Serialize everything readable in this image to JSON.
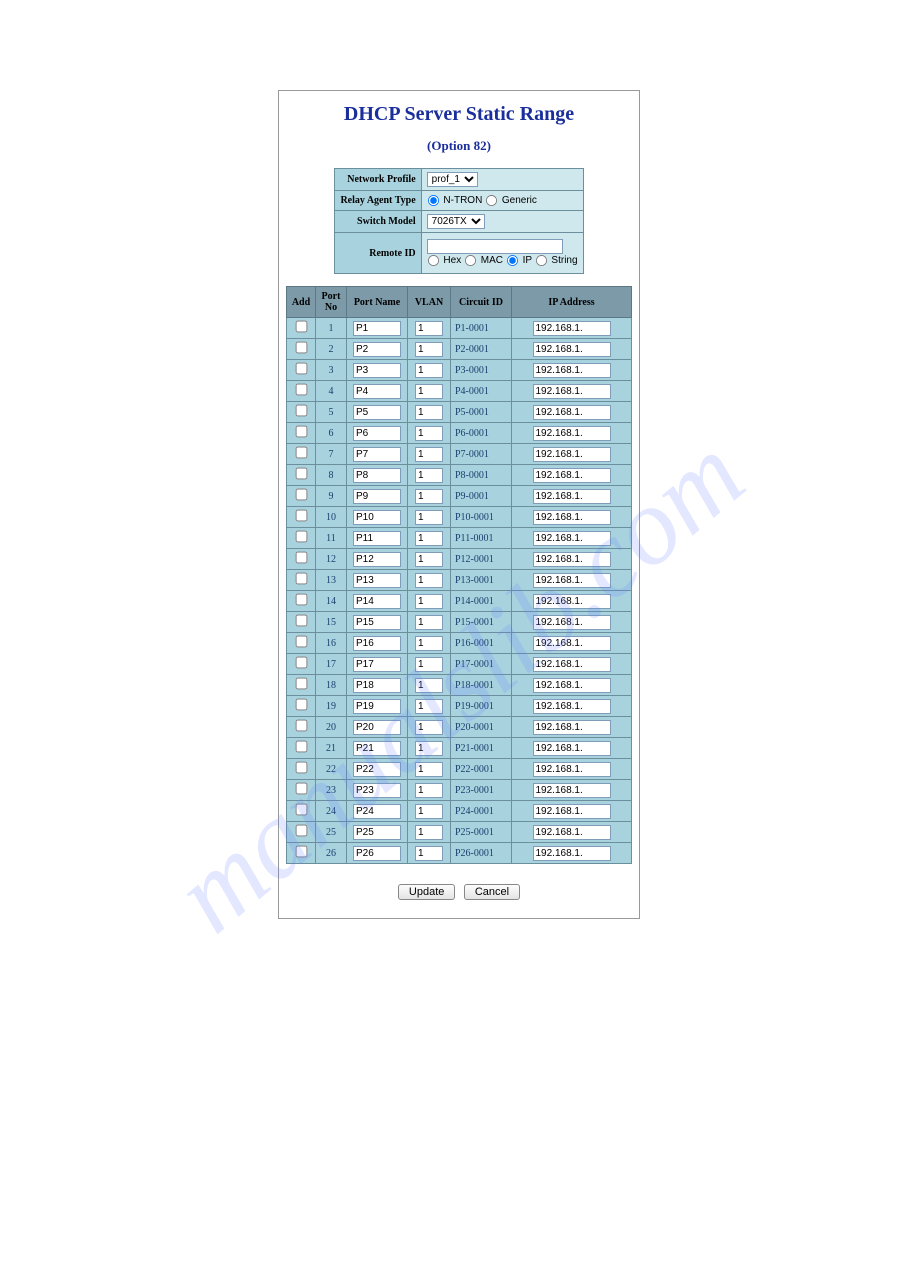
{
  "title": "DHCP Server Static Range",
  "subtitle": "(Option 82)",
  "config": {
    "network_profile_label": "Network Profile",
    "network_profile_value": "prof_1",
    "relay_agent_type_label": "Relay Agent Type",
    "relay_agent_ntron": "N-TRON",
    "relay_agent_generic": "Generic",
    "relay_agent_selected": "ntron",
    "switch_model_label": "Switch Model",
    "switch_model_value": "7026TX",
    "remote_id_label": "Remote ID",
    "remote_id_value": "",
    "remote_id_opt_hex": "Hex",
    "remote_id_opt_mac": "MAC",
    "remote_id_opt_ip": "IP",
    "remote_id_opt_string": "String",
    "remote_id_selected": "ip"
  },
  "table_headers": {
    "add": "Add",
    "port_no": "Port No",
    "port_name": "Port Name",
    "vlan": "VLAN",
    "circuit_id": "Circuit ID",
    "ip": "IP Address"
  },
  "rows": [
    {
      "no": "1",
      "pname": "P1",
      "vlan": "1",
      "cid": "P1-0001",
      "ip": "192.168.1."
    },
    {
      "no": "2",
      "pname": "P2",
      "vlan": "1",
      "cid": "P2-0001",
      "ip": "192.168.1."
    },
    {
      "no": "3",
      "pname": "P3",
      "vlan": "1",
      "cid": "P3-0001",
      "ip": "192.168.1."
    },
    {
      "no": "4",
      "pname": "P4",
      "vlan": "1",
      "cid": "P4-0001",
      "ip": "192.168.1."
    },
    {
      "no": "5",
      "pname": "P5",
      "vlan": "1",
      "cid": "P5-0001",
      "ip": "192.168.1."
    },
    {
      "no": "6",
      "pname": "P6",
      "vlan": "1",
      "cid": "P6-0001",
      "ip": "192.168.1."
    },
    {
      "no": "7",
      "pname": "P7",
      "vlan": "1",
      "cid": "P7-0001",
      "ip": "192.168.1."
    },
    {
      "no": "8",
      "pname": "P8",
      "vlan": "1",
      "cid": "P8-0001",
      "ip": "192.168.1."
    },
    {
      "no": "9",
      "pname": "P9",
      "vlan": "1",
      "cid": "P9-0001",
      "ip": "192.168.1."
    },
    {
      "no": "10",
      "pname": "P10",
      "vlan": "1",
      "cid": "P10-0001",
      "ip": "192.168.1."
    },
    {
      "no": "11",
      "pname": "P11",
      "vlan": "1",
      "cid": "P11-0001",
      "ip": "192.168.1."
    },
    {
      "no": "12",
      "pname": "P12",
      "vlan": "1",
      "cid": "P12-0001",
      "ip": "192.168.1."
    },
    {
      "no": "13",
      "pname": "P13",
      "vlan": "1",
      "cid": "P13-0001",
      "ip": "192.168.1."
    },
    {
      "no": "14",
      "pname": "P14",
      "vlan": "1",
      "cid": "P14-0001",
      "ip": "192.168.1."
    },
    {
      "no": "15",
      "pname": "P15",
      "vlan": "1",
      "cid": "P15-0001",
      "ip": "192.168.1."
    },
    {
      "no": "16",
      "pname": "P16",
      "vlan": "1",
      "cid": "P16-0001",
      "ip": "192.168.1."
    },
    {
      "no": "17",
      "pname": "P17",
      "vlan": "1",
      "cid": "P17-0001",
      "ip": "192.168.1."
    },
    {
      "no": "18",
      "pname": "P18",
      "vlan": "1",
      "cid": "P18-0001",
      "ip": "192.168.1."
    },
    {
      "no": "19",
      "pname": "P19",
      "vlan": "1",
      "cid": "P19-0001",
      "ip": "192.168.1."
    },
    {
      "no": "20",
      "pname": "P20",
      "vlan": "1",
      "cid": "P20-0001",
      "ip": "192.168.1."
    },
    {
      "no": "21",
      "pname": "P21",
      "vlan": "1",
      "cid": "P21-0001",
      "ip": "192.168.1."
    },
    {
      "no": "22",
      "pname": "P22",
      "vlan": "1",
      "cid": "P22-0001",
      "ip": "192.168.1."
    },
    {
      "no": "23",
      "pname": "P23",
      "vlan": "1",
      "cid": "P23-0001",
      "ip": "192.168.1."
    },
    {
      "no": "24",
      "pname": "P24",
      "vlan": "1",
      "cid": "P24-0001",
      "ip": "192.168.1."
    },
    {
      "no": "25",
      "pname": "P25",
      "vlan": "1",
      "cid": "P25-0001",
      "ip": "192.168.1."
    },
    {
      "no": "26",
      "pname": "P26",
      "vlan": "1",
      "cid": "P26-0001",
      "ip": "192.168.1."
    }
  ],
  "buttons": {
    "update": "Update",
    "cancel": "Cancel"
  },
  "watermark": "manualslib.com"
}
